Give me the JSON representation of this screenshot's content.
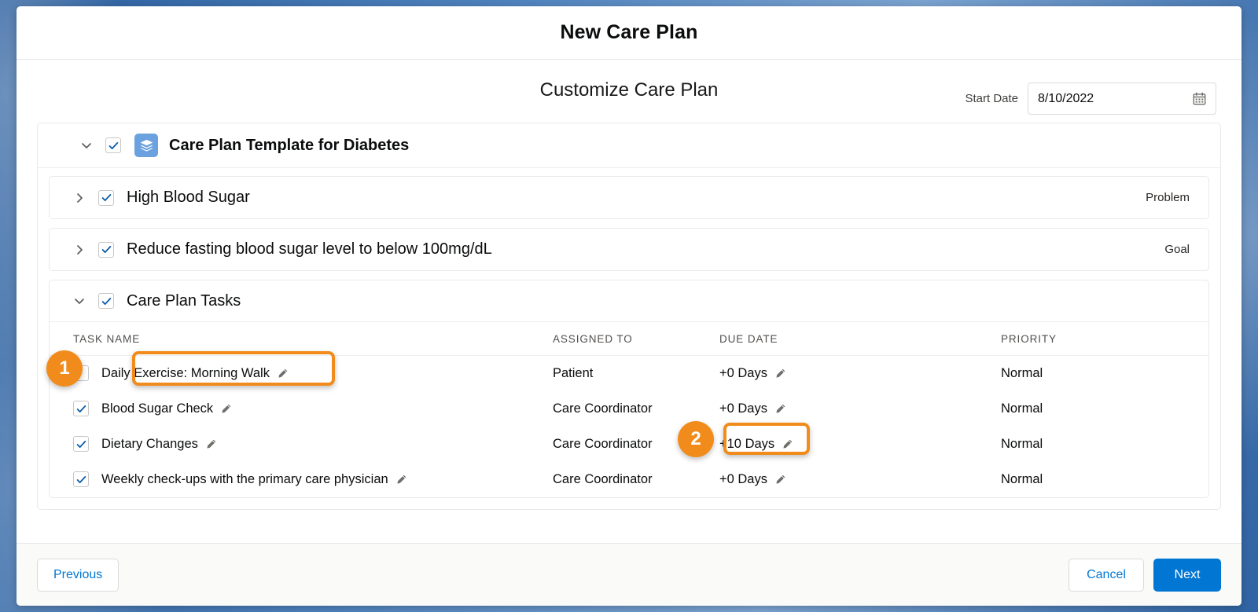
{
  "window": {
    "title": "New Care Plan"
  },
  "subheader": {
    "title": "Customize Care Plan",
    "start_date_label": "Start Date",
    "start_date_value": "8/10/2022",
    "calendar_icon": "calendar-icon"
  },
  "template": {
    "name": "Care Plan Template for Diabetes",
    "icon": "stacked-layers-icon",
    "expanded": true,
    "checked": true
  },
  "nodes": [
    {
      "label": "High Blood Sugar",
      "type": "Problem",
      "expanded": false,
      "checked": true
    },
    {
      "label": "Reduce fasting blood sugar level to below 100mg/dL",
      "type": "Goal",
      "expanded": false,
      "checked": true
    }
  ],
  "tasks_section": {
    "label": "Care Plan Tasks",
    "expanded": true,
    "checked": true,
    "columns": [
      "TASK NAME",
      "ASSIGNED TO",
      "DUE DATE",
      "PRIORITY"
    ],
    "rows": [
      {
        "checked": false,
        "name": "Daily Exercise: Morning Walk",
        "assigned_to": "Patient",
        "due_date": "+0 Days",
        "priority": "Normal"
      },
      {
        "checked": true,
        "name": "Blood Sugar Check",
        "assigned_to": "Care Coordinator",
        "due_date": "+0 Days",
        "priority": "Normal"
      },
      {
        "checked": true,
        "name": "Dietary Changes",
        "assigned_to": "Care Coordinator",
        "due_date": "+10 Days",
        "priority": "Normal"
      },
      {
        "checked": true,
        "name": "Weekly check-ups with the primary care physician",
        "assigned_to": "Care Coordinator",
        "due_date": "+0 Days",
        "priority": "Normal"
      }
    ]
  },
  "footer": {
    "previous": "Previous",
    "cancel": "Cancel",
    "next": "Next"
  },
  "annotations": [
    {
      "number": "1",
      "target": "task-row-1-checkbox-and-name"
    },
    {
      "number": "2",
      "target": "task-row-3-due-date"
    }
  ],
  "colors": {
    "accent_blue": "#0176d3",
    "template_icon_blue": "#6ba1de",
    "annotation_orange": "#f18c1c",
    "checkbox_check": "#0b5cab"
  }
}
